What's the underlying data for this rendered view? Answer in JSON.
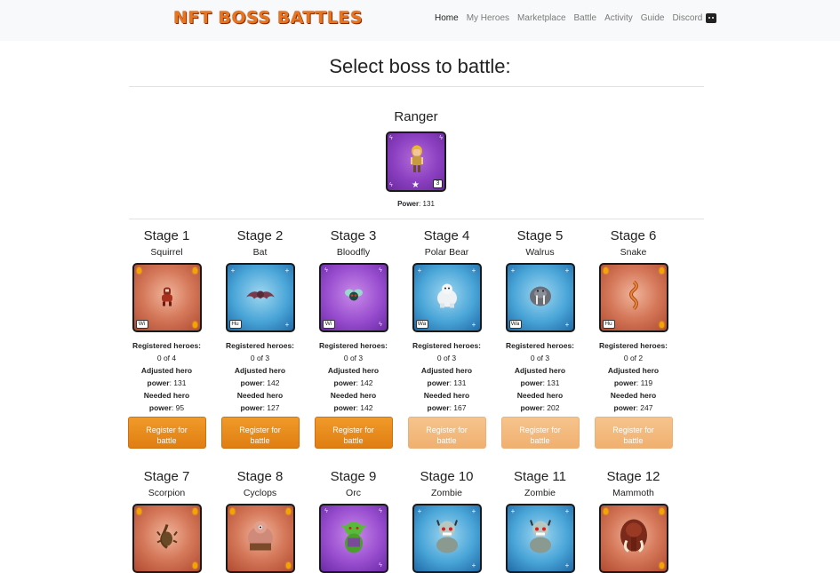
{
  "nav": {
    "brand": "NFT BOSS BATTLES",
    "links": [
      "Home",
      "My Heroes",
      "Marketplace",
      "Battle",
      "Activity",
      "Guide",
      "Discord"
    ]
  },
  "page": {
    "title": "Select boss to battle:"
  },
  "hero": {
    "name": "Ranger",
    "level": "3",
    "power_label": "Power",
    "power_value": ": 131"
  },
  "labels": {
    "registered": "Registered heroes:",
    "adjusted1": "Adjusted hero",
    "adjusted2": "power",
    "needed1": "Needed hero",
    "needed2": "power",
    "button1": "Register for",
    "button2": "battle"
  },
  "stages": [
    {
      "title": "Stage 1",
      "boss": "Squirrel",
      "badge": "Wi",
      "element": "fire",
      "registered": "0 of 4",
      "adjusted": ": 131",
      "needed": ": 95",
      "enabled": true,
      "icon": "squirrel-icon"
    },
    {
      "title": "Stage 2",
      "boss": "Bat",
      "badge": "Hu",
      "element": "water",
      "registered": "0 of 3",
      "adjusted": ": 142",
      "needed": ": 127",
      "enabled": true,
      "icon": "bat-icon"
    },
    {
      "title": "Stage 3",
      "boss": "Bloodfly",
      "badge": "Wi",
      "element": "lightning",
      "registered": "0 of 3",
      "adjusted": ": 142",
      "needed": ": 142",
      "enabled": true,
      "icon": "bloodfly-icon"
    },
    {
      "title": "Stage 4",
      "boss": "Polar Bear",
      "badge": "Wa",
      "element": "water",
      "registered": "0 of 3",
      "adjusted": ": 131",
      "needed": ": 167",
      "enabled": false,
      "icon": "polar-bear-icon"
    },
    {
      "title": "Stage 5",
      "boss": "Walrus",
      "badge": "Wa",
      "element": "water",
      "registered": "0 of 3",
      "adjusted": ": 131",
      "needed": ": 202",
      "enabled": false,
      "icon": "walrus-icon"
    },
    {
      "title": "Stage 6",
      "boss": "Snake",
      "badge": "Hu",
      "element": "fire",
      "registered": "0 of 2",
      "adjusted": ": 119",
      "needed": ": 247",
      "enabled": false,
      "icon": "snake-icon"
    },
    {
      "title": "Stage 7",
      "boss": "Scorpion",
      "element": "fire",
      "icon": "scorpion-icon"
    },
    {
      "title": "Stage 8",
      "boss": "Cyclops",
      "element": "fire",
      "icon": "cyclops-icon"
    },
    {
      "title": "Stage 9",
      "boss": "Orc",
      "element": "lightning",
      "icon": "orc-icon"
    },
    {
      "title": "Stage 10",
      "boss": "Zombie",
      "element": "water",
      "icon": "zombie-icon"
    },
    {
      "title": "Stage 11",
      "boss": "Zombie",
      "element": "water",
      "icon": "zombie-icon"
    },
    {
      "title": "Stage 12",
      "boss": "Mammoth",
      "element": "fire",
      "icon": "mammoth-icon"
    }
  ]
}
